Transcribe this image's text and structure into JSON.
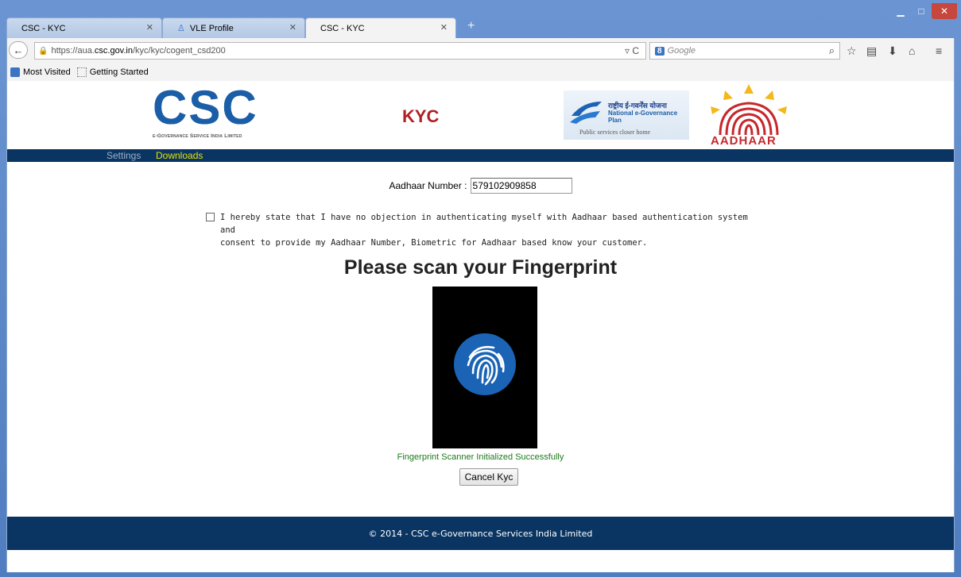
{
  "browser": {
    "tabs": [
      {
        "title": "CSC - KYC",
        "active": false
      },
      {
        "title": "VLE Profile",
        "active": false
      },
      {
        "title": "CSC - KYC",
        "active": true
      }
    ],
    "url_prefix": "https://aua.",
    "url_domain": "csc.gov.in",
    "url_path": "/kyc/kyc/cogent_csd200",
    "search_placeholder": "Google",
    "bookmarks": [
      "Most Visited",
      "Getting Started"
    ]
  },
  "header": {
    "logo_letters": [
      "C",
      "S",
      "C"
    ],
    "logo_subtitle": "e-Governance Service India Limited",
    "page_title": "KYC",
    "egov_hindi": "राष्ट्रीय ई-गवर्नेंस योजना",
    "egov_english": "National e-Governance Plan",
    "egov_tagline": "Public services closer home",
    "aadhaar_text": "AADHAAR"
  },
  "nav": {
    "settings": "Settings",
    "downloads": "Downloads"
  },
  "form": {
    "aadhaar_label": "Aadhaar Number :",
    "aadhaar_value": "579102909858",
    "consent_checked": false,
    "consent_text_1": "I hereby state that I have no objection in authenticating myself with Aadhaar based authentication system and",
    "consent_text_2": "consent to provide my Aadhaar Number, Biometric for Aadhaar based know your customer.",
    "scan_heading": "Please scan your Fingerprint",
    "scanner_status": "Fingerprint Scanner Initialized Successfully",
    "cancel_label": "Cancel Kyc"
  },
  "footer": {
    "copyright": "© 2014 - CSC e-Governance Services India Limited"
  },
  "colors": {
    "brand_blue": "#1b5ea8",
    "nav_bg": "#0a3563",
    "kyc_red": "#b11f24",
    "downloads_yellow": "#e8e000",
    "status_green": "#1b7a1b"
  }
}
